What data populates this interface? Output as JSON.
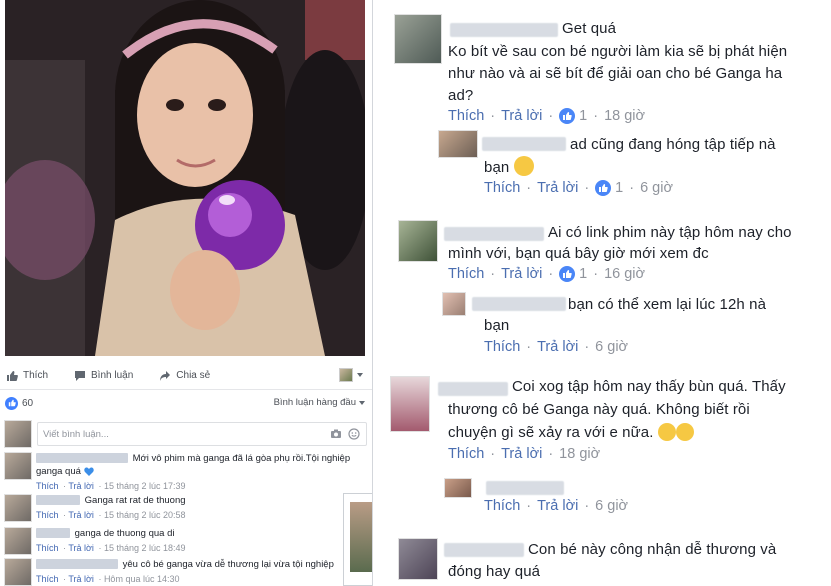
{
  "left": {
    "actions": {
      "like": "Thích",
      "comment": "Bình luận",
      "share": "Chia sẻ"
    },
    "likes_count": "60",
    "sort_label": "Bình luận hàng đầu",
    "write_placeholder": "Viết bình luận...",
    "comments": [
      {
        "text": "Mới vô phim mà ganga đã lá gòa phụ rồi.Tội nghiệp ganga quá",
        "meta": {
          "like": "Thích",
          "reply": "Trả lời",
          "time": "15 tháng 2 lúc 17:39"
        }
      },
      {
        "text": "Ganga rat rat de thuong",
        "meta": {
          "like": "Thích",
          "reply": "Trả lời",
          "time": "15 tháng 2 lúc 20:58"
        }
      },
      {
        "text": "ganga de thuong qua di",
        "meta": {
          "like": "Thích",
          "reply": "Trả lời",
          "time": "15 tháng 2 lúc 18:49"
        }
      },
      {
        "text": "yêu cô bé ganga vừa dễ thương lại vừa tội nghiệp",
        "meta": {
          "like": "Thích",
          "reply": "Trả lời",
          "time": "Hôm qua lúc 14:30"
        }
      }
    ]
  },
  "right": {
    "comments": [
      {
        "top_text": "Get quá",
        "line1": "Ko bít về sau con bé người làm kia sẽ bị phát hiện",
        "line2": "như nào và ai sẽ bít để giải oan cho bé Ganga ha",
        "line3": "ad?",
        "meta": {
          "like": "Thích",
          "reply": "Trả lời",
          "count": "1",
          "time": "18 giờ"
        }
      },
      {
        "line1": "ad cũng đang hóng tập tiếp nà",
        "line2": "bạn",
        "meta": {
          "like": "Thích",
          "reply": "Trả lời",
          "count": "1",
          "time": "6 giờ"
        }
      },
      {
        "line1": "Ai có link phim này tập hôm nay cho",
        "line2": "mình với, bạn quá bây giờ mới xem đc",
        "meta": {
          "like": "Thích",
          "reply": "Trả lời",
          "count": "1",
          "time": "16 giờ"
        }
      },
      {
        "line1": "bạn có thể xem lại lúc 12h nà",
        "line2": "bạn",
        "meta": {
          "like": "Thích",
          "reply": "Trả lời",
          "time": "6 giờ"
        }
      },
      {
        "line1": "Coi xog tập hôm nay thấy bùn quá. Thấy",
        "line2": "thương cô bé Ganga này quá. Không biết rồi",
        "line3": "chuyện gì sẽ xảy ra với e nữa.",
        "meta": {
          "like": "Thích",
          "reply": "Trả lời",
          "time": "18 giờ"
        }
      },
      {
        "meta": {
          "like": "Thích",
          "reply": "Trả lời",
          "time": "6 giờ"
        }
      },
      {
        "line1": "Con bé này công nhận dễ thương và",
        "line2": "đóng hay quá"
      }
    ]
  },
  "colors": {
    "link": "#4b6eb0",
    "like_blue": "#4a86f7",
    "meta_gray": "#90949c"
  }
}
